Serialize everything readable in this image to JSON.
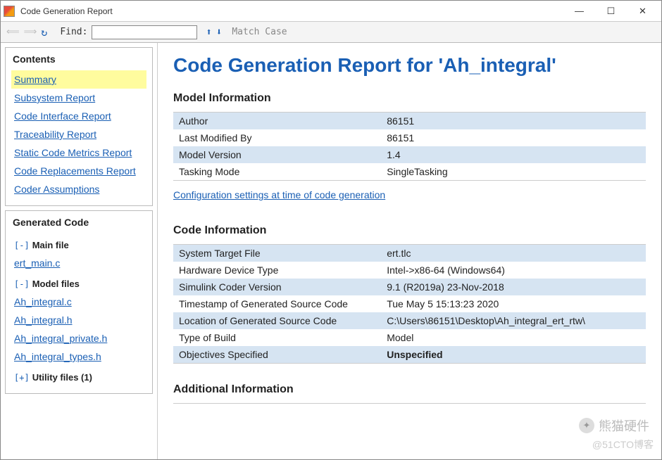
{
  "window": {
    "title": "Code Generation Report"
  },
  "toolbar": {
    "find_label": "Find:",
    "match_case": "Match Case"
  },
  "sidebar": {
    "contents_title": "Contents",
    "contents": [
      "Summary",
      "Subsystem Report",
      "Code Interface Report",
      "Traceability Report",
      "Static Code Metrics Report",
      "Code Replacements Report",
      "Coder Assumptions"
    ],
    "generated_title": "Generated Code",
    "main_file_label": "Main file",
    "main_files": [
      "ert_main.c"
    ],
    "model_files_label": "Model files",
    "model_files": [
      "Ah_integral.c",
      "Ah_integral.h",
      "Ah_integral_private.h",
      "Ah_integral_types.h"
    ],
    "utility_label": "Utility files (1)"
  },
  "page": {
    "title": "Code Generation Report for 'Ah_integral'",
    "model_info_title": "Model Information",
    "model_info": [
      {
        "k": "Author",
        "v": "86151"
      },
      {
        "k": "Last Modified By",
        "v": "86151"
      },
      {
        "k": "Model Version",
        "v": "1.4"
      },
      {
        "k": "Tasking Mode",
        "v": "SingleTasking"
      }
    ],
    "config_link": "Configuration settings at time of code generation",
    "code_info_title": "Code Information",
    "code_info": [
      {
        "k": "System Target File",
        "v": "ert.tlc"
      },
      {
        "k": "Hardware Device Type",
        "v": "Intel->x86-64 (Windows64)"
      },
      {
        "k": "Simulink Coder Version",
        "v": "9.1 (R2019a) 23-Nov-2018"
      },
      {
        "k": "Timestamp of Generated Source Code",
        "v": "Tue May 5 15:13:23 2020"
      },
      {
        "k": "Location of Generated Source Code",
        "v": "C:\\Users\\86151\\Desktop\\Ah_integral_ert_rtw\\"
      },
      {
        "k": "Type of Build",
        "v": "Model"
      },
      {
        "k": "Objectives Specified",
        "v": "Unspecified",
        "cls": "unspecified"
      }
    ],
    "additional_title": "Additional Information"
  },
  "watermarks": {
    "w1": "熊猫硬件",
    "w2": "@51CTO博客"
  }
}
